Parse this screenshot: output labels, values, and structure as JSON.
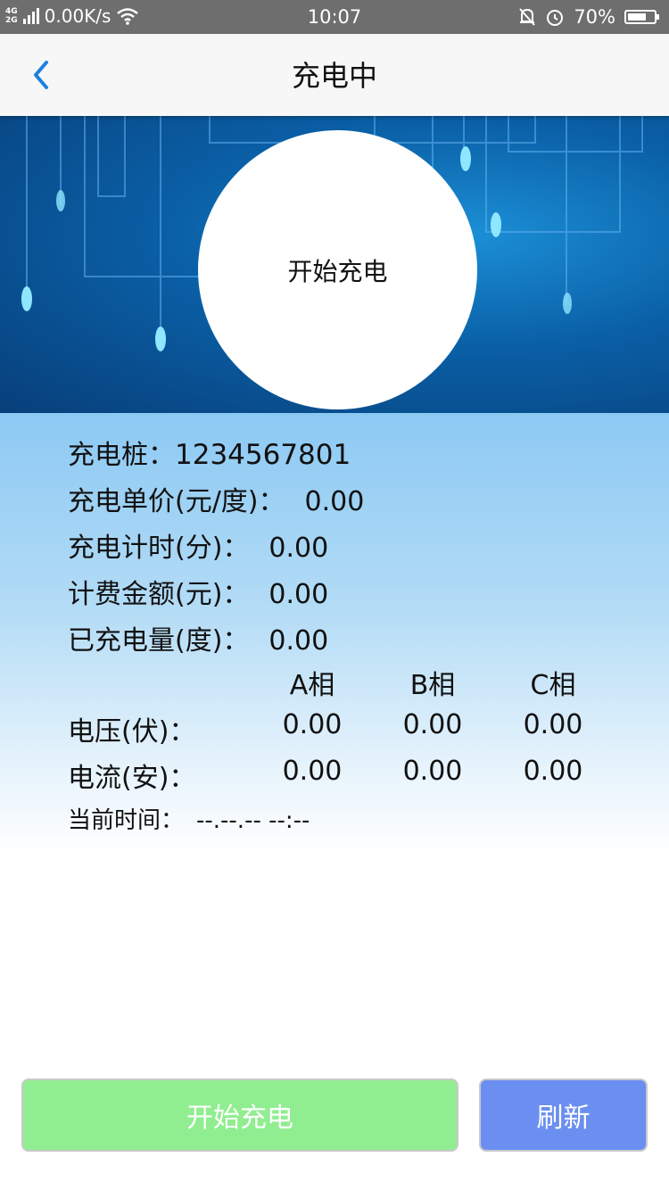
{
  "status_bar": {
    "network_top": "4G",
    "network_bottom": "2G",
    "speed": "0.00K/s",
    "time": "10:07",
    "battery": "70%",
    "battery_level": 0.7,
    "icons": [
      "signal-icon",
      "wifi-icon",
      "mute-icon",
      "alarm-icon",
      "battery-icon"
    ]
  },
  "header": {
    "title": "充电中",
    "back_icon": "chevron-left-icon",
    "accent": "#1e7fe0"
  },
  "hero": {
    "circle_label": "开始充电"
  },
  "info": {
    "pile_label": "充电桩：",
    "pile_value": "1234567801",
    "unit_price_label": "充电单价(元/度)：",
    "unit_price_value": "0.00",
    "timer_label": "充电计时(分)：",
    "timer_value": "0.00",
    "amount_label": "计费金额(元)：",
    "amount_value": "0.00",
    "energy_label": "已充电量(度)：",
    "energy_value": "0.00",
    "phases": [
      "A相",
      "B相",
      "C相"
    ],
    "voltage_label": "电压(伏)：",
    "voltage": [
      "0.00",
      "0.00",
      "0.00"
    ],
    "current_label": "电流(安)：",
    "current": [
      "0.00",
      "0.00",
      "0.00"
    ],
    "now_label": "当前时间：",
    "now_value": "--.--.-- --:--"
  },
  "buttons": {
    "start_label": "开始充电",
    "start_color": "#90ee90",
    "refresh_label": "刷新",
    "refresh_color": "#6b8ff0"
  }
}
